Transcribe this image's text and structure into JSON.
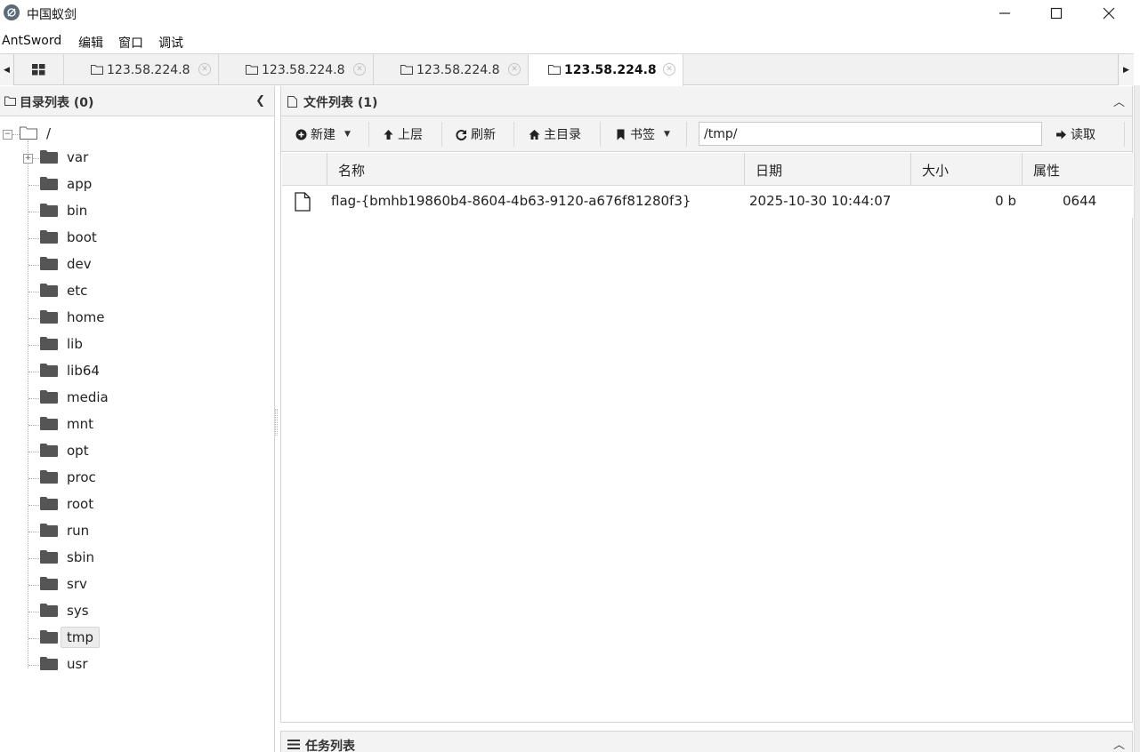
{
  "window": {
    "title": "中国蚁剑",
    "controls": {
      "minimize": "minimize",
      "maximize": "maximize",
      "close": "close"
    }
  },
  "menu": [
    "AntSword",
    "编辑",
    "窗口",
    "调试"
  ],
  "tabs": [
    {
      "label": "123.58.224.8",
      "active": false
    },
    {
      "label": "123.58.224.8",
      "active": false
    },
    {
      "label": "123.58.224.8",
      "active": false
    },
    {
      "label": "123.58.224.8",
      "active": true
    }
  ],
  "left_panel": {
    "title": "目录列表 (0)",
    "root": "/",
    "folders": [
      "var",
      "app",
      "bin",
      "boot",
      "dev",
      "etc",
      "home",
      "lib",
      "lib64",
      "media",
      "mnt",
      "opt",
      "proc",
      "root",
      "run",
      "sbin",
      "srv",
      "sys",
      "tmp",
      "usr"
    ],
    "selected": "tmp"
  },
  "file_panel": {
    "title": "文件列表 (1)",
    "toolbar": {
      "new": "新建",
      "up": "上层",
      "refresh": "刷新",
      "home": "主目录",
      "bookmark": "书签",
      "path": "/tmp/",
      "read": "读取"
    },
    "columns": [
      "名称",
      "日期",
      "大小",
      "属性"
    ],
    "rows": [
      {
        "name": "flag-{bmhb19860b4-8604-4b63-9120-a676f81280f3}",
        "date": "2025-10-30 10:44:07",
        "size": "0 b",
        "attr": "0644"
      }
    ]
  },
  "task_panel": {
    "title": "任务列表"
  },
  "colors": {
    "header_bg": "#f3f3f3",
    "border": "#d4d4d4",
    "folder": "#555555"
  }
}
